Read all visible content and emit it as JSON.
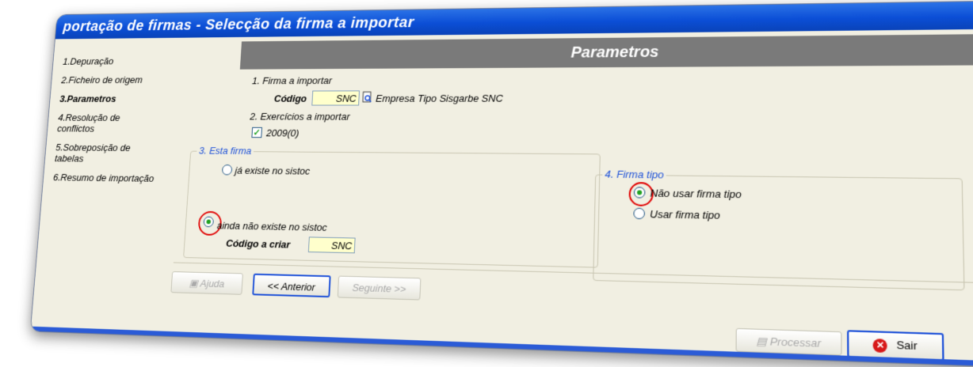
{
  "window": {
    "title": "portação de firmas - Selecção da firma a importar"
  },
  "steps": [
    {
      "label": "1.Depuração"
    },
    {
      "label": "2.Ficheiro de origem"
    },
    {
      "label": "3.Parametros"
    },
    {
      "label": "4.Resolução de conflictos"
    },
    {
      "label": "5.Sobreposição de tabelas"
    },
    {
      "label": "6.Resumo de importação"
    }
  ],
  "panel": {
    "header": "Parametros",
    "firma_importar": {
      "section_label": "1. Firma a importar",
      "codigo_label": "Código",
      "codigo_value": "SNC",
      "firma_name": "Empresa Tipo Sisgarbe SNC"
    },
    "exercicios": {
      "section_label": "2. Exercícios a importar",
      "item_label": "2009(0)"
    },
    "esta_firma": {
      "title": "3. Esta firma",
      "option1": "já existe no sistoc",
      "option2": "ainda não existe no sistoc",
      "codigo_criar_label": "Código a criar",
      "codigo_criar_value": "SNC"
    },
    "firma_tipo": {
      "title": "4. Firma tipo",
      "option1": "Não usar firma tipo",
      "option2": "Usar firma tipo"
    }
  },
  "buttons": {
    "ajuda": "Ajuda",
    "anterior": "<< Anterior",
    "seguinte": "Seguinte >>",
    "processar": "Processar",
    "sair": "Sair"
  },
  "colors": {
    "title_bar": "#0b4ed6",
    "accent": "#1b4fd8",
    "highlight_circle": "#e00000",
    "input_bg": "#ffffcc"
  }
}
